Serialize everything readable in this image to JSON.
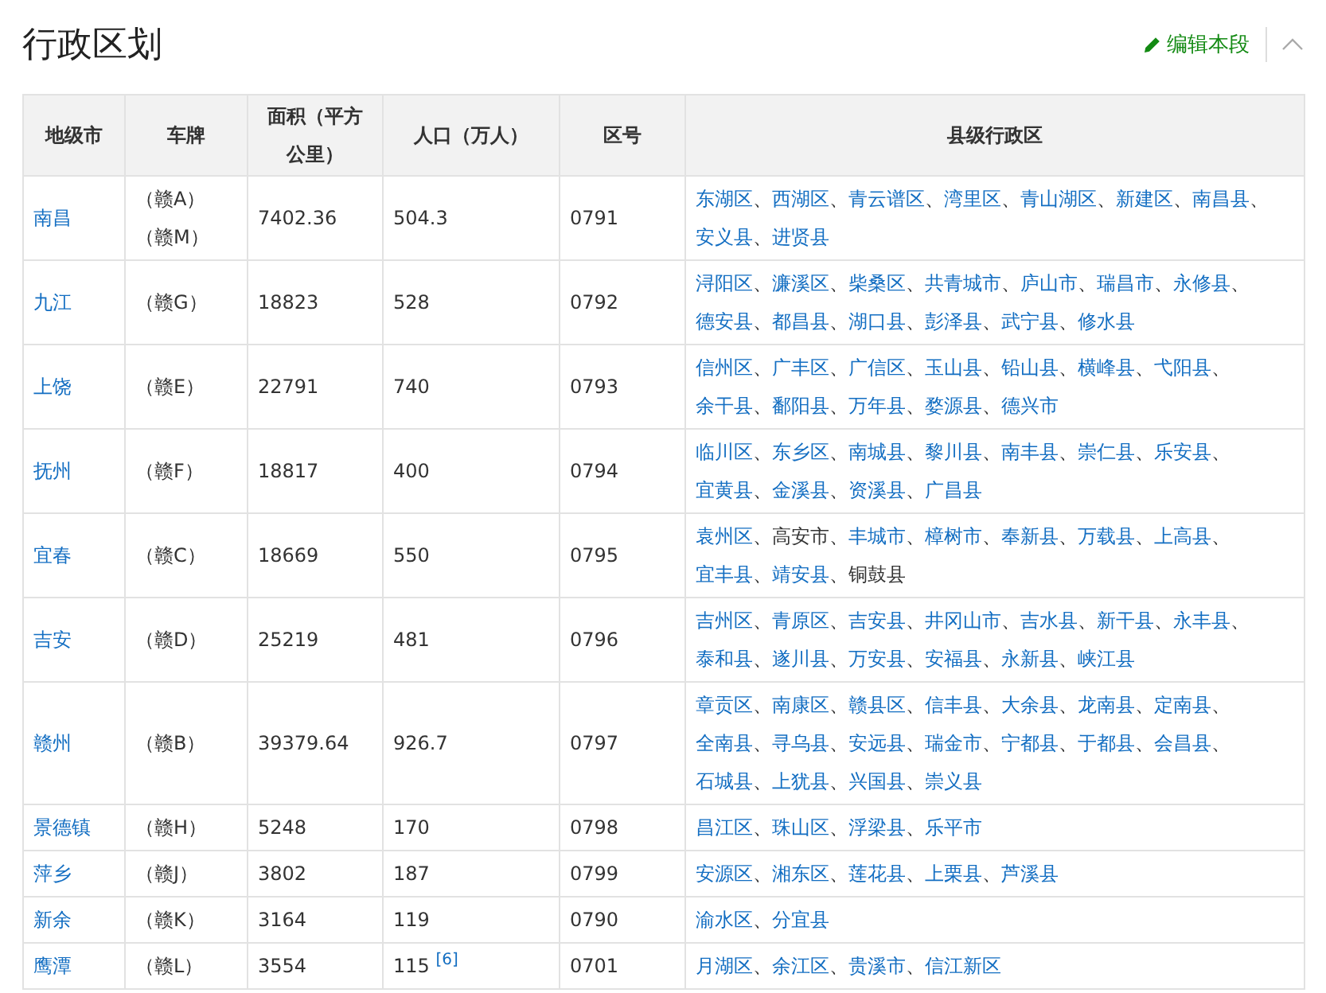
{
  "section": {
    "title": "行政区划",
    "edit_link": "编辑本段",
    "collapsed": false
  },
  "table": {
    "columns": [
      "地级市",
      "车牌",
      "面积（平方公里）",
      "人口（万人）",
      "区号",
      "县级行政区"
    ],
    "separator": "、",
    "rows": [
      {
        "city": "南昌",
        "plates": [
          "（赣A）",
          "（赣M）"
        ],
        "area": "7402.36",
        "population": "504.3",
        "code": "0791",
        "counties": [
          {
            "name": "东湖区",
            "link": true
          },
          {
            "name": "西湖区",
            "link": true
          },
          {
            "name": "青云谱区",
            "link": true
          },
          {
            "name": "湾里区",
            "link": true
          },
          {
            "name": "青山湖区",
            "link": true
          },
          {
            "name": "新建区",
            "link": true
          },
          {
            "name": "南昌县",
            "link": true
          },
          {
            "name": "安义县",
            "link": true
          },
          {
            "name": "进贤县",
            "link": true
          }
        ]
      },
      {
        "city": "九江",
        "plates": [
          "（赣G）"
        ],
        "area": "18823",
        "population": "528",
        "code": "0792",
        "counties": [
          {
            "name": "浔阳区",
            "link": true
          },
          {
            "name": "濂溪区",
            "link": true
          },
          {
            "name": "柴桑区",
            "link": true
          },
          {
            "name": "共青城市",
            "link": true
          },
          {
            "name": "庐山市",
            "link": true
          },
          {
            "name": "瑞昌市",
            "link": true
          },
          {
            "name": "永修县",
            "link": true
          },
          {
            "name": "德安县",
            "link": true
          },
          {
            "name": "都昌县",
            "link": true
          },
          {
            "name": "湖口县",
            "link": true
          },
          {
            "name": "彭泽县",
            "link": true
          },
          {
            "name": "武宁县",
            "link": true
          },
          {
            "name": "修水县",
            "link": true
          }
        ]
      },
      {
        "city": "上饶",
        "plates": [
          "（赣E）"
        ],
        "area": "22791",
        "population": "740",
        "code": "0793",
        "counties": [
          {
            "name": "信州区",
            "link": true
          },
          {
            "name": "广丰区",
            "link": true
          },
          {
            "name": "广信区",
            "link": true
          },
          {
            "name": "玉山县",
            "link": true
          },
          {
            "name": "铅山县",
            "link": true
          },
          {
            "name": "横峰县",
            "link": true
          },
          {
            "name": "弋阳县",
            "link": true
          },
          {
            "name": "余干县",
            "link": true
          },
          {
            "name": "鄱阳县",
            "link": true
          },
          {
            "name": "万年县",
            "link": true
          },
          {
            "name": "婺源县",
            "link": true
          },
          {
            "name": "德兴市",
            "link": true
          }
        ]
      },
      {
        "city": "抚州",
        "plates": [
          "（赣F）"
        ],
        "area": "18817",
        "population": "400",
        "code": "0794",
        "counties": [
          {
            "name": "临川区",
            "link": true
          },
          {
            "name": "东乡区",
            "link": true
          },
          {
            "name": "南城县",
            "link": true
          },
          {
            "name": "黎川县",
            "link": true
          },
          {
            "name": "南丰县",
            "link": true
          },
          {
            "name": "崇仁县",
            "link": true
          },
          {
            "name": "乐安县",
            "link": true
          },
          {
            "name": "宜黄县",
            "link": true
          },
          {
            "name": "金溪县",
            "link": true
          },
          {
            "name": "资溪县",
            "link": true
          },
          {
            "name": "广昌县",
            "link": true
          }
        ]
      },
      {
        "city": "宜春",
        "plates": [
          "（赣C）"
        ],
        "area": "18669",
        "population": "550",
        "code": "0795",
        "counties": [
          {
            "name": "袁州区",
            "link": true
          },
          {
            "name": "高安市",
            "link": false
          },
          {
            "name": "丰城市",
            "link": true
          },
          {
            "name": "樟树市",
            "link": true
          },
          {
            "name": "奉新县",
            "link": true
          },
          {
            "name": "万载县",
            "link": true
          },
          {
            "name": "上高县",
            "link": true
          },
          {
            "name": "宜丰县",
            "link": true
          },
          {
            "name": "靖安县",
            "link": true
          },
          {
            "name": "铜鼓县",
            "link": false
          }
        ]
      },
      {
        "city": "吉安",
        "plates": [
          "（赣D）"
        ],
        "area": "25219",
        "population": "481",
        "code": "0796",
        "counties": [
          {
            "name": "吉州区",
            "link": true
          },
          {
            "name": "青原区",
            "link": true
          },
          {
            "name": "吉安县",
            "link": true
          },
          {
            "name": "井冈山市",
            "link": true
          },
          {
            "name": "吉水县",
            "link": true
          },
          {
            "name": "新干县",
            "link": true
          },
          {
            "name": "永丰县",
            "link": true
          },
          {
            "name": "泰和县",
            "link": true
          },
          {
            "name": "遂川县",
            "link": true
          },
          {
            "name": "万安县",
            "link": true
          },
          {
            "name": "安福县",
            "link": true
          },
          {
            "name": "永新县",
            "link": true
          },
          {
            "name": "峡江县",
            "link": true
          }
        ]
      },
      {
        "city": "赣州",
        "plates": [
          "（赣B）"
        ],
        "area": "39379.64",
        "population": "926.7",
        "code": "0797",
        "counties": [
          {
            "name": "章贡区",
            "link": true
          },
          {
            "name": "南康区",
            "link": true
          },
          {
            "name": "赣县区",
            "link": true
          },
          {
            "name": "信丰县",
            "link": true
          },
          {
            "name": "大余县",
            "link": true
          },
          {
            "name": "龙南县",
            "link": true
          },
          {
            "name": "定南县",
            "link": true
          },
          {
            "name": "全南县",
            "link": true
          },
          {
            "name": "寻乌县",
            "link": true
          },
          {
            "name": "安远县",
            "link": true
          },
          {
            "name": "瑞金市",
            "link": true
          },
          {
            "name": "宁都县",
            "link": true
          },
          {
            "name": "于都县",
            "link": true
          },
          {
            "name": "会昌县",
            "link": true
          },
          {
            "name": "石城县",
            "link": true
          },
          {
            "name": "上犹县",
            "link": true
          },
          {
            "name": "兴国县",
            "link": true
          },
          {
            "name": "崇义县",
            "link": true
          }
        ]
      },
      {
        "city": "景德镇",
        "plates": [
          "（赣H）"
        ],
        "area": "5248",
        "population": "170",
        "code": "0798",
        "counties": [
          {
            "name": "昌江区",
            "link": true
          },
          {
            "name": "珠山区",
            "link": true
          },
          {
            "name": "浮梁县",
            "link": true
          },
          {
            "name": "乐平市",
            "link": true
          }
        ]
      },
      {
        "city": "萍乡",
        "plates": [
          "（赣J）"
        ],
        "area": "3802",
        "population": "187",
        "code": "0799",
        "counties": [
          {
            "name": "安源区",
            "link": true
          },
          {
            "name": "湘东区",
            "link": true
          },
          {
            "name": "莲花县",
            "link": true
          },
          {
            "name": "上栗县",
            "link": true
          },
          {
            "name": "芦溪县",
            "link": true
          }
        ]
      },
      {
        "city": "新余",
        "plates": [
          "（赣K）"
        ],
        "area": "3164",
        "population": "119",
        "code": "0790",
        "counties": [
          {
            "name": "渝水区",
            "link": true
          },
          {
            "name": "分宜县",
            "link": true
          }
        ]
      },
      {
        "city": "鹰潭",
        "plates": [
          "（赣L）"
        ],
        "area": "3554",
        "population": "115 $^{[6]}$",
        "code": "0701",
        "counties": [
          {
            "name": "月湖区",
            "link": true
          },
          {
            "name": "余江区",
            "link": true
          },
          {
            "name": "贵溪市",
            "link": true
          },
          {
            "name": "信江新区",
            "link": true
          }
        ]
      }
    ]
  }
}
